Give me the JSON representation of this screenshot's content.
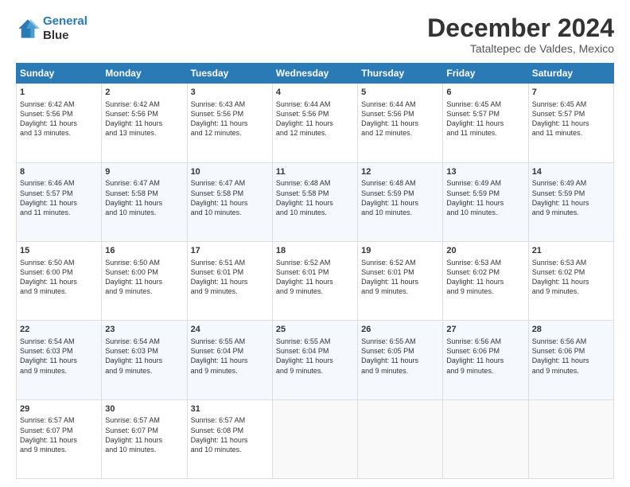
{
  "header": {
    "logo_line1": "General",
    "logo_line2": "Blue",
    "title": "December 2024",
    "subtitle": "Tataltepec de Valdes, Mexico"
  },
  "days_of_week": [
    "Sunday",
    "Monday",
    "Tuesday",
    "Wednesday",
    "Thursday",
    "Friday",
    "Saturday"
  ],
  "weeks": [
    [
      {
        "day": "1",
        "info": "Sunrise: 6:42 AM\nSunset: 5:56 PM\nDaylight: 11 hours\nand 13 minutes."
      },
      {
        "day": "2",
        "info": "Sunrise: 6:42 AM\nSunset: 5:56 PM\nDaylight: 11 hours\nand 13 minutes."
      },
      {
        "day": "3",
        "info": "Sunrise: 6:43 AM\nSunset: 5:56 PM\nDaylight: 11 hours\nand 12 minutes."
      },
      {
        "day": "4",
        "info": "Sunrise: 6:44 AM\nSunset: 5:56 PM\nDaylight: 11 hours\nand 12 minutes."
      },
      {
        "day": "5",
        "info": "Sunrise: 6:44 AM\nSunset: 5:56 PM\nDaylight: 11 hours\nand 12 minutes."
      },
      {
        "day": "6",
        "info": "Sunrise: 6:45 AM\nSunset: 5:57 PM\nDaylight: 11 hours\nand 11 minutes."
      },
      {
        "day": "7",
        "info": "Sunrise: 6:45 AM\nSunset: 5:57 PM\nDaylight: 11 hours\nand 11 minutes."
      }
    ],
    [
      {
        "day": "8",
        "info": "Sunrise: 6:46 AM\nSunset: 5:57 PM\nDaylight: 11 hours\nand 11 minutes."
      },
      {
        "day": "9",
        "info": "Sunrise: 6:47 AM\nSunset: 5:58 PM\nDaylight: 11 hours\nand 10 minutes."
      },
      {
        "day": "10",
        "info": "Sunrise: 6:47 AM\nSunset: 5:58 PM\nDaylight: 11 hours\nand 10 minutes."
      },
      {
        "day": "11",
        "info": "Sunrise: 6:48 AM\nSunset: 5:58 PM\nDaylight: 11 hours\nand 10 minutes."
      },
      {
        "day": "12",
        "info": "Sunrise: 6:48 AM\nSunset: 5:59 PM\nDaylight: 11 hours\nand 10 minutes."
      },
      {
        "day": "13",
        "info": "Sunrise: 6:49 AM\nSunset: 5:59 PM\nDaylight: 11 hours\nand 10 minutes."
      },
      {
        "day": "14",
        "info": "Sunrise: 6:49 AM\nSunset: 5:59 PM\nDaylight: 11 hours\nand 9 minutes."
      }
    ],
    [
      {
        "day": "15",
        "info": "Sunrise: 6:50 AM\nSunset: 6:00 PM\nDaylight: 11 hours\nand 9 minutes."
      },
      {
        "day": "16",
        "info": "Sunrise: 6:50 AM\nSunset: 6:00 PM\nDaylight: 11 hours\nand 9 minutes."
      },
      {
        "day": "17",
        "info": "Sunrise: 6:51 AM\nSunset: 6:01 PM\nDaylight: 11 hours\nand 9 minutes."
      },
      {
        "day": "18",
        "info": "Sunrise: 6:52 AM\nSunset: 6:01 PM\nDaylight: 11 hours\nand 9 minutes."
      },
      {
        "day": "19",
        "info": "Sunrise: 6:52 AM\nSunset: 6:01 PM\nDaylight: 11 hours\nand 9 minutes."
      },
      {
        "day": "20",
        "info": "Sunrise: 6:53 AM\nSunset: 6:02 PM\nDaylight: 11 hours\nand 9 minutes."
      },
      {
        "day": "21",
        "info": "Sunrise: 6:53 AM\nSunset: 6:02 PM\nDaylight: 11 hours\nand 9 minutes."
      }
    ],
    [
      {
        "day": "22",
        "info": "Sunrise: 6:54 AM\nSunset: 6:03 PM\nDaylight: 11 hours\nand 9 minutes."
      },
      {
        "day": "23",
        "info": "Sunrise: 6:54 AM\nSunset: 6:03 PM\nDaylight: 11 hours\nand 9 minutes."
      },
      {
        "day": "24",
        "info": "Sunrise: 6:55 AM\nSunset: 6:04 PM\nDaylight: 11 hours\nand 9 minutes."
      },
      {
        "day": "25",
        "info": "Sunrise: 6:55 AM\nSunset: 6:04 PM\nDaylight: 11 hours\nand 9 minutes."
      },
      {
        "day": "26",
        "info": "Sunrise: 6:55 AM\nSunset: 6:05 PM\nDaylight: 11 hours\nand 9 minutes."
      },
      {
        "day": "27",
        "info": "Sunrise: 6:56 AM\nSunset: 6:06 PM\nDaylight: 11 hours\nand 9 minutes."
      },
      {
        "day": "28",
        "info": "Sunrise: 6:56 AM\nSunset: 6:06 PM\nDaylight: 11 hours\nand 9 minutes."
      }
    ],
    [
      {
        "day": "29",
        "info": "Sunrise: 6:57 AM\nSunset: 6:07 PM\nDaylight: 11 hours\nand 9 minutes."
      },
      {
        "day": "30",
        "info": "Sunrise: 6:57 AM\nSunset: 6:07 PM\nDaylight: 11 hours\nand 10 minutes."
      },
      {
        "day": "31",
        "info": "Sunrise: 6:57 AM\nSunset: 6:08 PM\nDaylight: 11 hours\nand 10 minutes."
      },
      {
        "day": "",
        "info": ""
      },
      {
        "day": "",
        "info": ""
      },
      {
        "day": "",
        "info": ""
      },
      {
        "day": "",
        "info": ""
      }
    ]
  ]
}
